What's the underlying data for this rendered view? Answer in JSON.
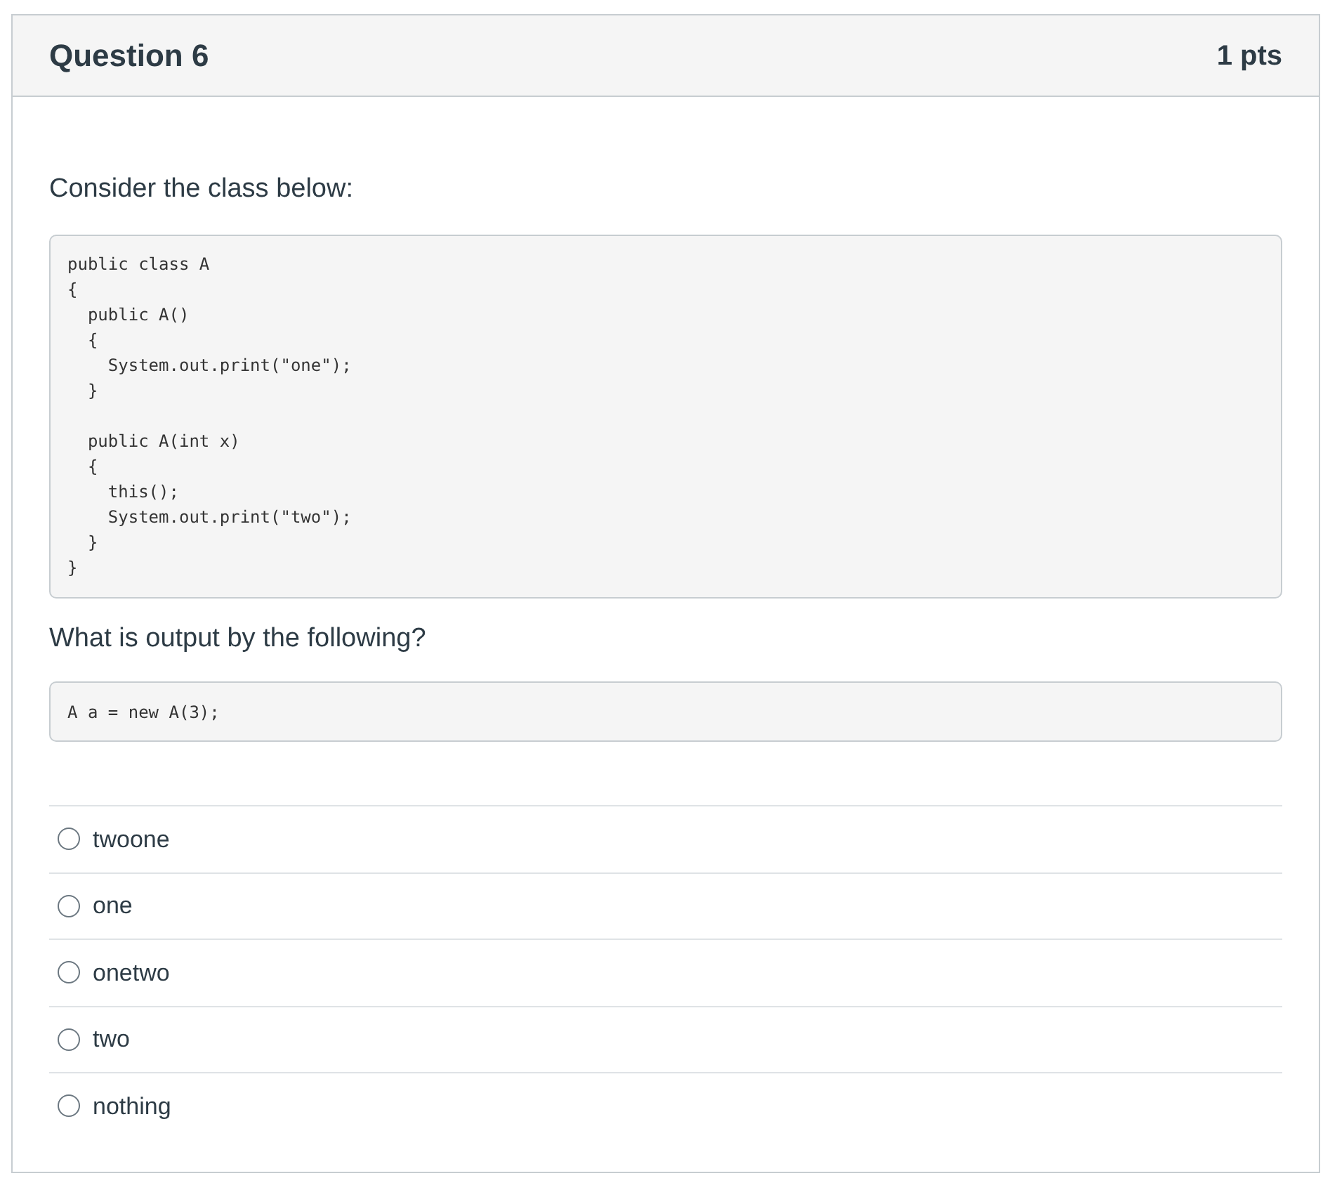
{
  "question": {
    "title": "Question 6",
    "points": "1 pts"
  },
  "prompt": "Consider the class below:",
  "code": "public class A\n{\n  public A()\n  {\n    System.out.print(\"one\");\n  }\n\n  public A(int x)\n  {\n    this();\n    System.out.print(\"two\");\n  }\n}",
  "followup": "What is output by the following?",
  "snippet": "A a = new A(3);",
  "answers": [
    {
      "label": "twoone",
      "selected": false
    },
    {
      "label": "one",
      "selected": false
    },
    {
      "label": "onetwo",
      "selected": false
    },
    {
      "label": "two",
      "selected": false
    },
    {
      "label": "nothing",
      "selected": false
    }
  ]
}
